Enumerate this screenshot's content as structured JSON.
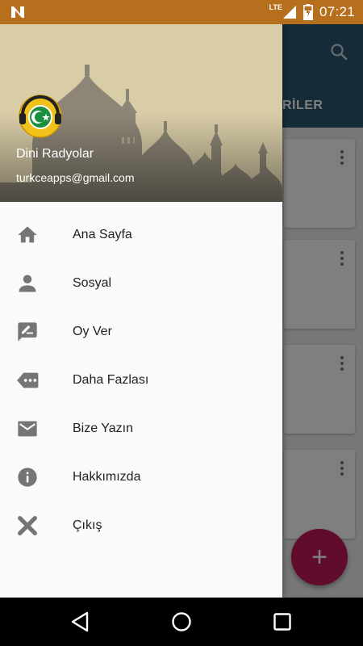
{
  "status_bar": {
    "network": "LTE",
    "time": "07:21"
  },
  "background_app": {
    "tab_label_partial": "İRİLER",
    "fab_label": "+"
  },
  "drawer": {
    "header": {
      "title": "Dini Radyolar",
      "email": "turkceapps@gmail.com"
    },
    "menu": [
      {
        "label": "Ana Sayfa",
        "icon": "home-icon"
      },
      {
        "label": "Sosyal",
        "icon": "person-icon"
      },
      {
        "label": "Oy Ver",
        "icon": "rate-review-icon"
      },
      {
        "label": "Daha Fazlası",
        "icon": "more-icon"
      },
      {
        "label": "Bize Yazın",
        "icon": "email-icon"
      },
      {
        "label": "Hakkımızda",
        "icon": "info-icon"
      },
      {
        "label": "Çıkış",
        "icon": "close-icon"
      }
    ]
  },
  "colors": {
    "status_bar": "#b56f1d",
    "toolbar": "#2a5670",
    "fab": "#c2185b",
    "icon": "#757575"
  }
}
